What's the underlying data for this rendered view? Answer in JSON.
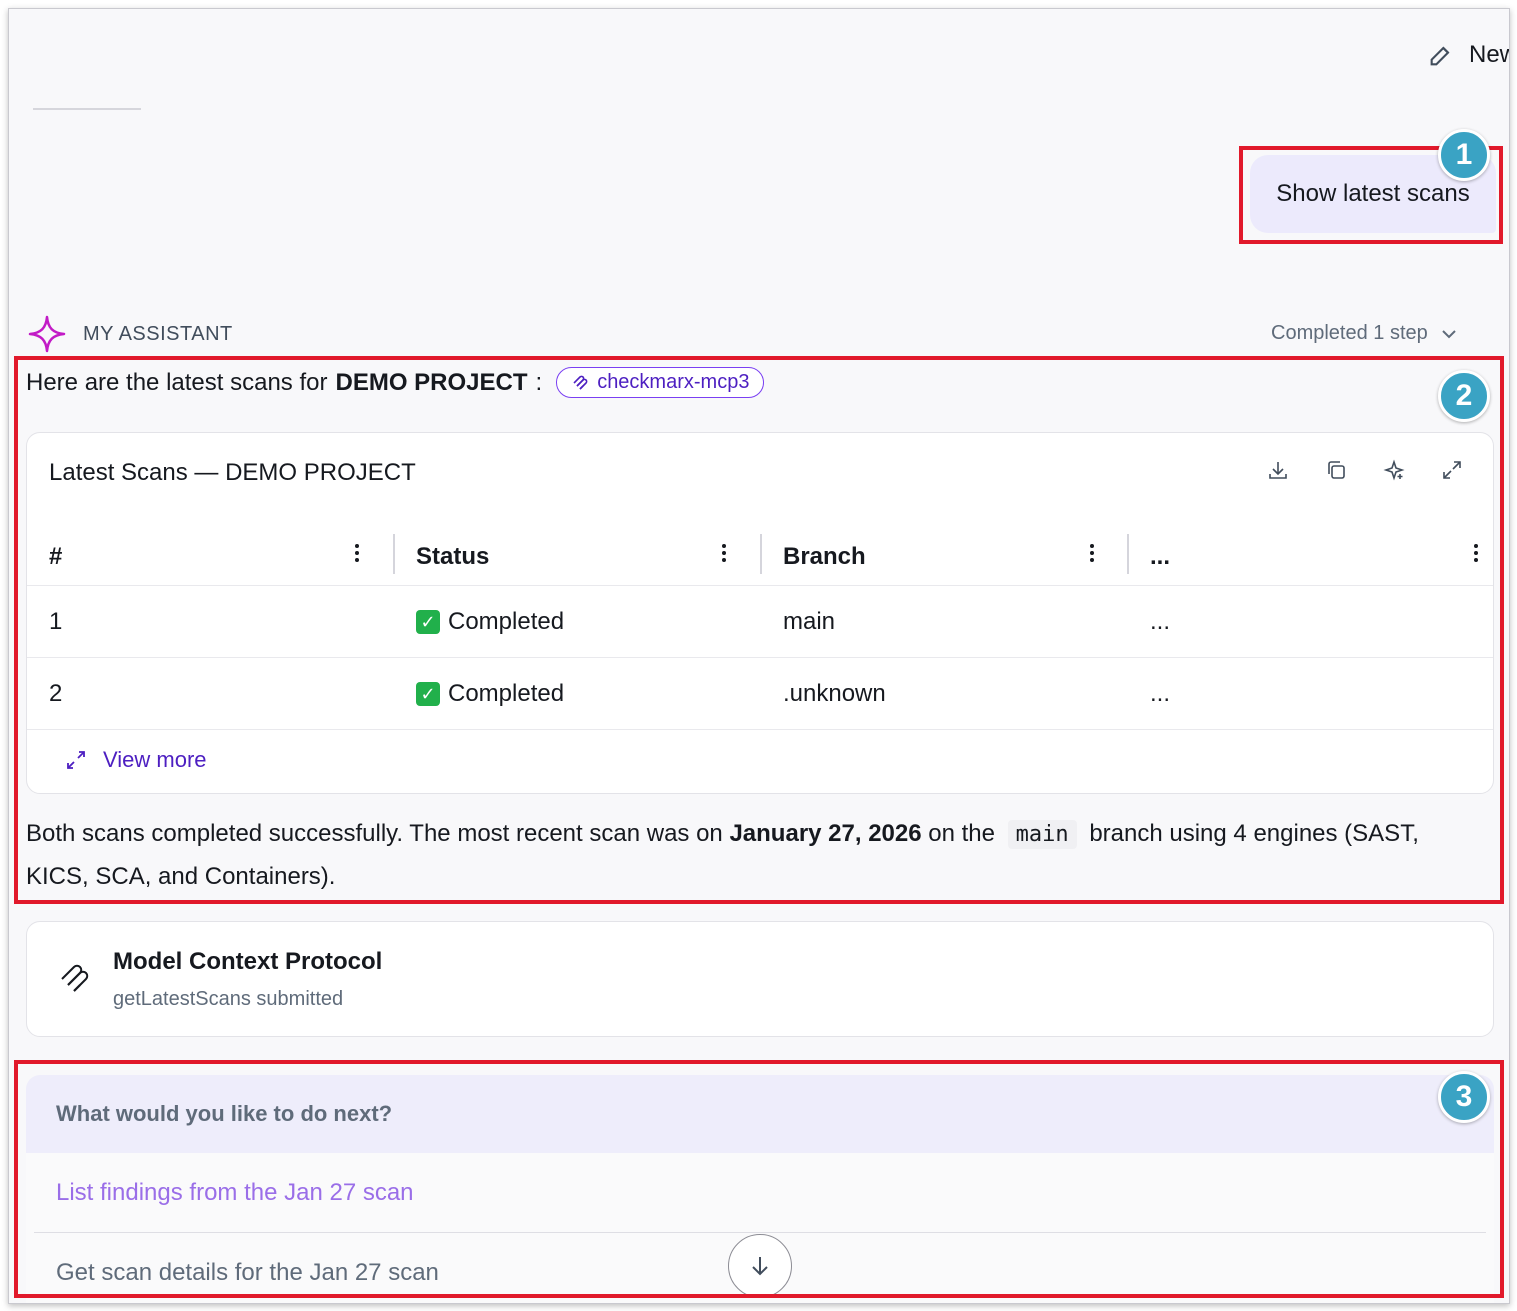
{
  "header": {
    "new_chat_label": "New"
  },
  "user_message": {
    "text": "Show latest scans"
  },
  "assistant": {
    "label": "MY ASSISTANT",
    "status": "Completed 1 step",
    "intro_prefix": "Here are the latest scans for ",
    "intro_project": "DEMO PROJECT",
    "intro_suffix": " :",
    "tool_tag": "checkmarx-mcp3"
  },
  "table": {
    "title": "Latest Scans — DEMO PROJECT",
    "columns": [
      "#",
      "Status",
      "Branch",
      "..."
    ],
    "rows": [
      {
        "num": "1",
        "status": "Completed",
        "branch": "main",
        "more": "..."
      },
      {
        "num": "2",
        "status": "Completed",
        "branch": ".unknown",
        "more": "..."
      }
    ],
    "view_more": "View more"
  },
  "summary": {
    "part1": "Both scans completed successfully. The most recent scan was on ",
    "date": "January 27, 2026",
    "part2": " on the",
    "branch_code": "main",
    "part3": "branch using 4 engines (SAST, KICS, SCA, and Containers)."
  },
  "mcp_card": {
    "title": "Model Context Protocol",
    "subtitle": "getLatestScans submitted"
  },
  "next_steps": {
    "heading": "What would you like to do next?",
    "options": [
      "List findings from the Jan 27 scan",
      "Get scan details for the Jan 27 scan"
    ]
  },
  "annotations": {
    "badge1": "1",
    "badge2": "2",
    "badge3": "3"
  },
  "colors": {
    "highlight": "#e1192b",
    "badge": "#3aa3c4",
    "accent": "#7a3ff2",
    "link": "#4d1fc1"
  }
}
